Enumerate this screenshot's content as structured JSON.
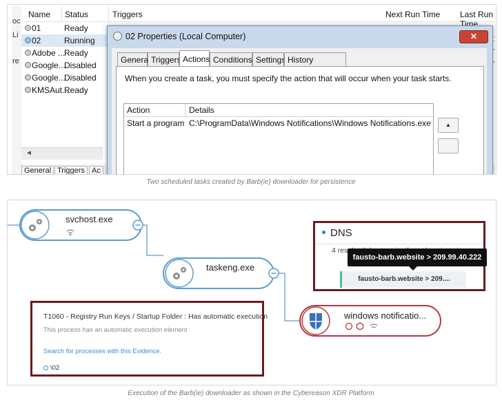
{
  "figure1": {
    "left_strip_fragments": [
      "oc",
      "Li",
      "re"
    ],
    "columns": [
      "Name",
      "Status",
      "Triggers",
      "Next Run Time",
      "Last Run Time"
    ],
    "tasks": [
      {
        "name": "01",
        "status": "Ready",
        "selected": false
      },
      {
        "name": "02",
        "status": "Running",
        "selected": true
      },
      {
        "name": "Adobe ...",
        "status": "Ready",
        "selected": false
      },
      {
        "name": "Google...",
        "status": "Disabled",
        "selected": false
      },
      {
        "name": "Google...",
        "status": "Disabled",
        "selected": false
      },
      {
        "name": "KMSAut...",
        "status": "Ready",
        "selected": false
      }
    ],
    "right_fragments": [
      "1",
      "?",
      "?"
    ],
    "bottom_tabs": [
      "General",
      "Triggers",
      "Ac"
    ],
    "dialog": {
      "title": "02 Properties (Local Computer)",
      "close_icon": "close-x",
      "tabs": [
        "General",
        "Triggers",
        "Actions",
        "Conditions",
        "Settings",
        "History (disabled)"
      ],
      "active_tab": "Actions",
      "description": "When you create a task, you must specify the action that will occur when your task starts.",
      "table_headers": [
        "Action",
        "Details"
      ],
      "rows": [
        {
          "action": "Start a program",
          "details": "C:\\ProgramData\\Windows Notifications\\Windows Notifications.exe"
        }
      ],
      "move_up_glyph": "▲"
    }
  },
  "caption1": "Two scheduled tasks created by Barb(ie) downloader for persistence",
  "figure2": {
    "nodes": [
      {
        "label": "svchost.exe",
        "icon": "gears-icon"
      },
      {
        "label": "taskeng.exe",
        "icon": "gears-icon"
      },
      {
        "label": "windows notificatio...",
        "icon": "shield-app-icon"
      }
    ],
    "dns": {
      "title": "DNS",
      "subtitle": "4 resolved dns queries from domain to ip",
      "entry": "fausto-barb.website > 209....",
      "tooltip": "fausto-barb.website > 209.99.40.222"
    },
    "evidence": {
      "title": "T1060 - Registry Run Keys / Startup Folder : Has automatic execution",
      "description": "This process has an automatic execution element",
      "link": "Search for processes with this Evidence.",
      "value": "\\02"
    },
    "colors": {
      "node_border_blue": "#5b9bd0",
      "node_border_red": "#b5373e",
      "highlight_box": "#6b1a1f",
      "accent_teal": "#4fb8a8"
    }
  },
  "caption2": "Execution of the Barb(ie) downloader as shown in the Cybereason XDR Platform"
}
